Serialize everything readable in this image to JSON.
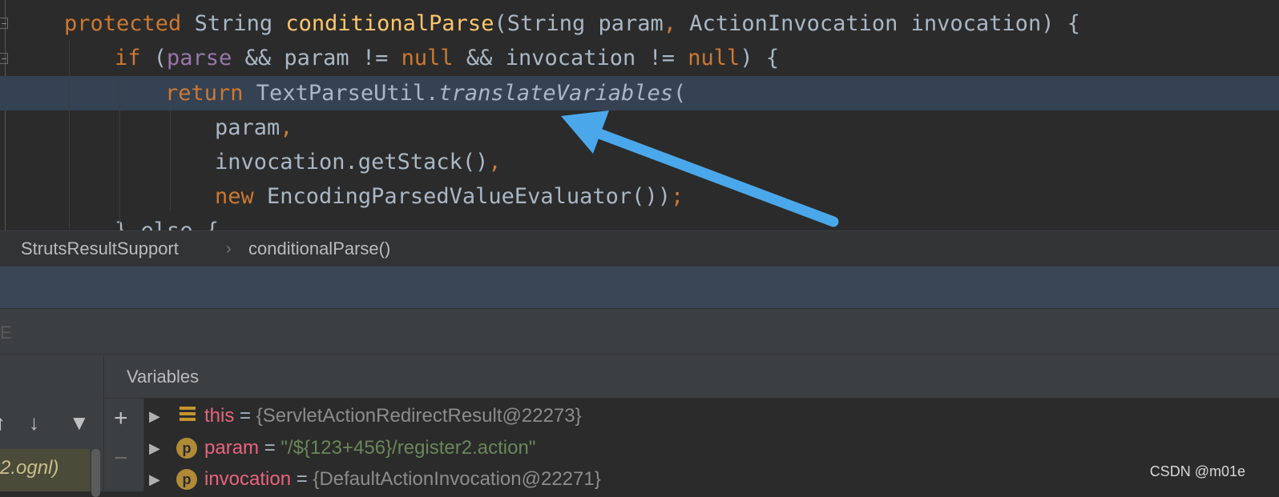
{
  "editor": {
    "lines": [
      {
        "segments": [
          {
            "t": "protected",
            "c": "kw"
          },
          {
            "t": " String ",
            "c": "pn"
          },
          {
            "t": "conditionalParse",
            "c": "fn"
          },
          {
            "t": "(String param",
            "c": "pn"
          },
          {
            "t": ",",
            "c": "kw"
          },
          {
            "t": " ActionInvocation invocation) {",
            "c": "pn"
          }
        ]
      },
      {
        "segments": [
          {
            "t": "if",
            "c": "kw"
          },
          {
            "t": " (",
            "c": "pn"
          },
          {
            "t": "parse",
            "c": "fld"
          },
          {
            "t": " && param != ",
            "c": "pn"
          },
          {
            "t": "null",
            "c": "kw"
          },
          {
            "t": " && invocation != ",
            "c": "pn"
          },
          {
            "t": "null",
            "c": "kw"
          },
          {
            "t": ") {",
            "c": "pn"
          }
        ]
      },
      {
        "segments": [
          {
            "t": "return",
            "c": "kw"
          },
          {
            "t": " TextParseUtil.",
            "c": "pn"
          },
          {
            "t": "translateVariables",
            "c": "it"
          },
          {
            "t": "(",
            "c": "pn"
          }
        ]
      },
      {
        "segments": [
          {
            "t": "param",
            "c": "pn"
          },
          {
            "t": ",",
            "c": "kw"
          }
        ]
      },
      {
        "segments": [
          {
            "t": "invocation.getStack()",
            "c": "pn"
          },
          {
            "t": ",",
            "c": "kw"
          }
        ]
      },
      {
        "segments": [
          {
            "t": "new",
            "c": "kw"
          },
          {
            "t": " EncodingParsedValueEvaluator())",
            "c": "pn"
          },
          {
            "t": ";",
            "c": "kw"
          }
        ]
      },
      {
        "segments": [
          {
            "t": "} else {",
            "c": "pn"
          }
        ]
      }
    ]
  },
  "breadcrumb": {
    "class_name": "StrutsResultSupport",
    "separator": "›",
    "method_name": "conditionalParse()"
  },
  "debug_header": {
    "mark": "E"
  },
  "frames": {
    "toolbar": {
      "up": "↑",
      "down": "↓",
      "filter": "▼"
    },
    "selected_frame": "2.ognl)"
  },
  "variables": {
    "title": "Variables",
    "add": "+",
    "remove": "−",
    "rows": [
      {
        "expander": "▶",
        "badge": "list",
        "name": "this",
        "eq": " = ",
        "value": "{ServletActionRedirectResult@22273}",
        "kind": "obj"
      },
      {
        "expander": "▶",
        "badge": "p",
        "name": "param",
        "eq": " = ",
        "value": "\"/${123+456}/register2.action\"",
        "kind": "str"
      },
      {
        "expander": "▶",
        "badge": "p",
        "name": "invocation",
        "eq": " = ",
        "value": "{DefaultActionInvocation@22271}",
        "kind": "obj"
      }
    ]
  },
  "watermark": "CSDN @m01e",
  "colors": {
    "background": "#2b2b2b",
    "highlight_line": "#344253",
    "keyword": "#cc7832",
    "method": "#ffc66d",
    "field": "#9876aa",
    "string": "#6a8759",
    "arrow": "#4aa8ea"
  }
}
